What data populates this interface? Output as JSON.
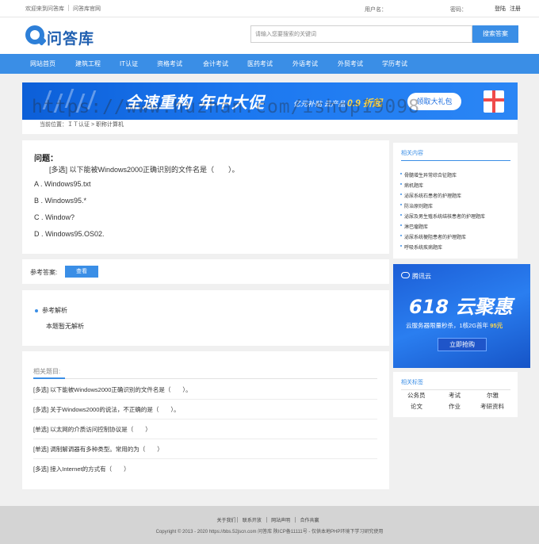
{
  "topbar": {
    "welcome": "欢迎来到问答库",
    "site_link": "问答库官网",
    "username_label": "用户名：",
    "password_label": "密码：",
    "login": "登陆",
    "register": "注册"
  },
  "header": {
    "logo_text": "问答库",
    "search_placeholder": "请输入您要搜索的关键词",
    "search_button": "搜索答案"
  },
  "nav": [
    "网站首页",
    "建筑工程",
    "IT认证",
    "资格考试",
    "会计考试",
    "医药考试",
    "外语考试",
    "外贸考试",
    "学历考试"
  ],
  "banner": {
    "title": "全速重构 年中大促",
    "subtitle_prefix": "亿元补贴 云产品",
    "subtitle_highlight": "0.9 折起",
    "button": "领取大礼包"
  },
  "watermark": "https://www.huzhan.com/ishop19098",
  "breadcrumb": "当前位置：ＩＴ认证 > 职称计算机",
  "question": {
    "label": "问题：",
    "text": "[多选] 以下能被Windows2000正确识别的文件名是（　　）。",
    "options": [
      "A . Windows95.txt",
      "B . Windows95.*",
      "C . Window?",
      "D . Windows95.OS02."
    ]
  },
  "answer": {
    "label": "参考答案:",
    "button": "查看"
  },
  "analysis": {
    "title": "参考解析",
    "body": "本题暂无解析"
  },
  "related": {
    "heading": "相关题目:",
    "items": [
      "[多选] 以下能被Windows2000正确识别的文件名是（　　）。",
      "[多选] 关于Windows2000的说法，不正确的是（　　）。",
      "[单选] 以太网的介质访问控制协议是（　　）",
      "[单选] 调制解调器有多种类型。常用的为（　　）",
      "[多选] 接入Internet的方式有（　　）"
    ]
  },
  "sidebar": {
    "related_content_heading": "相关内容",
    "related_content": [
      "骨髓增生异常综合征题库",
      "病机题库",
      "泌尿系统石患者的护理题库",
      "防治原则题库",
      "泌尿及男生殖系统结核患者的护理题库",
      "淋巴瘤题库",
      "泌尿系统梗阻患者的护理题库",
      "呼吸系统疾病题库"
    ],
    "tags_heading": "相关标签",
    "tags": [
      "公务员",
      "考试",
      "尔雅",
      "论文",
      "作业",
      "考研资料"
    ]
  },
  "ad": {
    "brand": "腾讯云",
    "headline": "618 云聚惠",
    "sub_prefix": "云服务器限量秒杀，1核2G首年",
    "sub_highlight": "95元",
    "button": "立即抢购"
  },
  "footer": {
    "links": [
      "关于我们",
      "联系开放",
      "网站声明",
      "合作共赢"
    ],
    "copyright": "Copyright © 2013 - 2020 https://bbs.52jscn.com  问答库  陕ICP备11111号 - 仅供本地PHP环境下学习研究使用"
  },
  "colors": {
    "accent": "#3a8ee6",
    "logo": "#1f5fb0",
    "background": "#f0f0f0",
    "footer": "#d4d4d4"
  }
}
